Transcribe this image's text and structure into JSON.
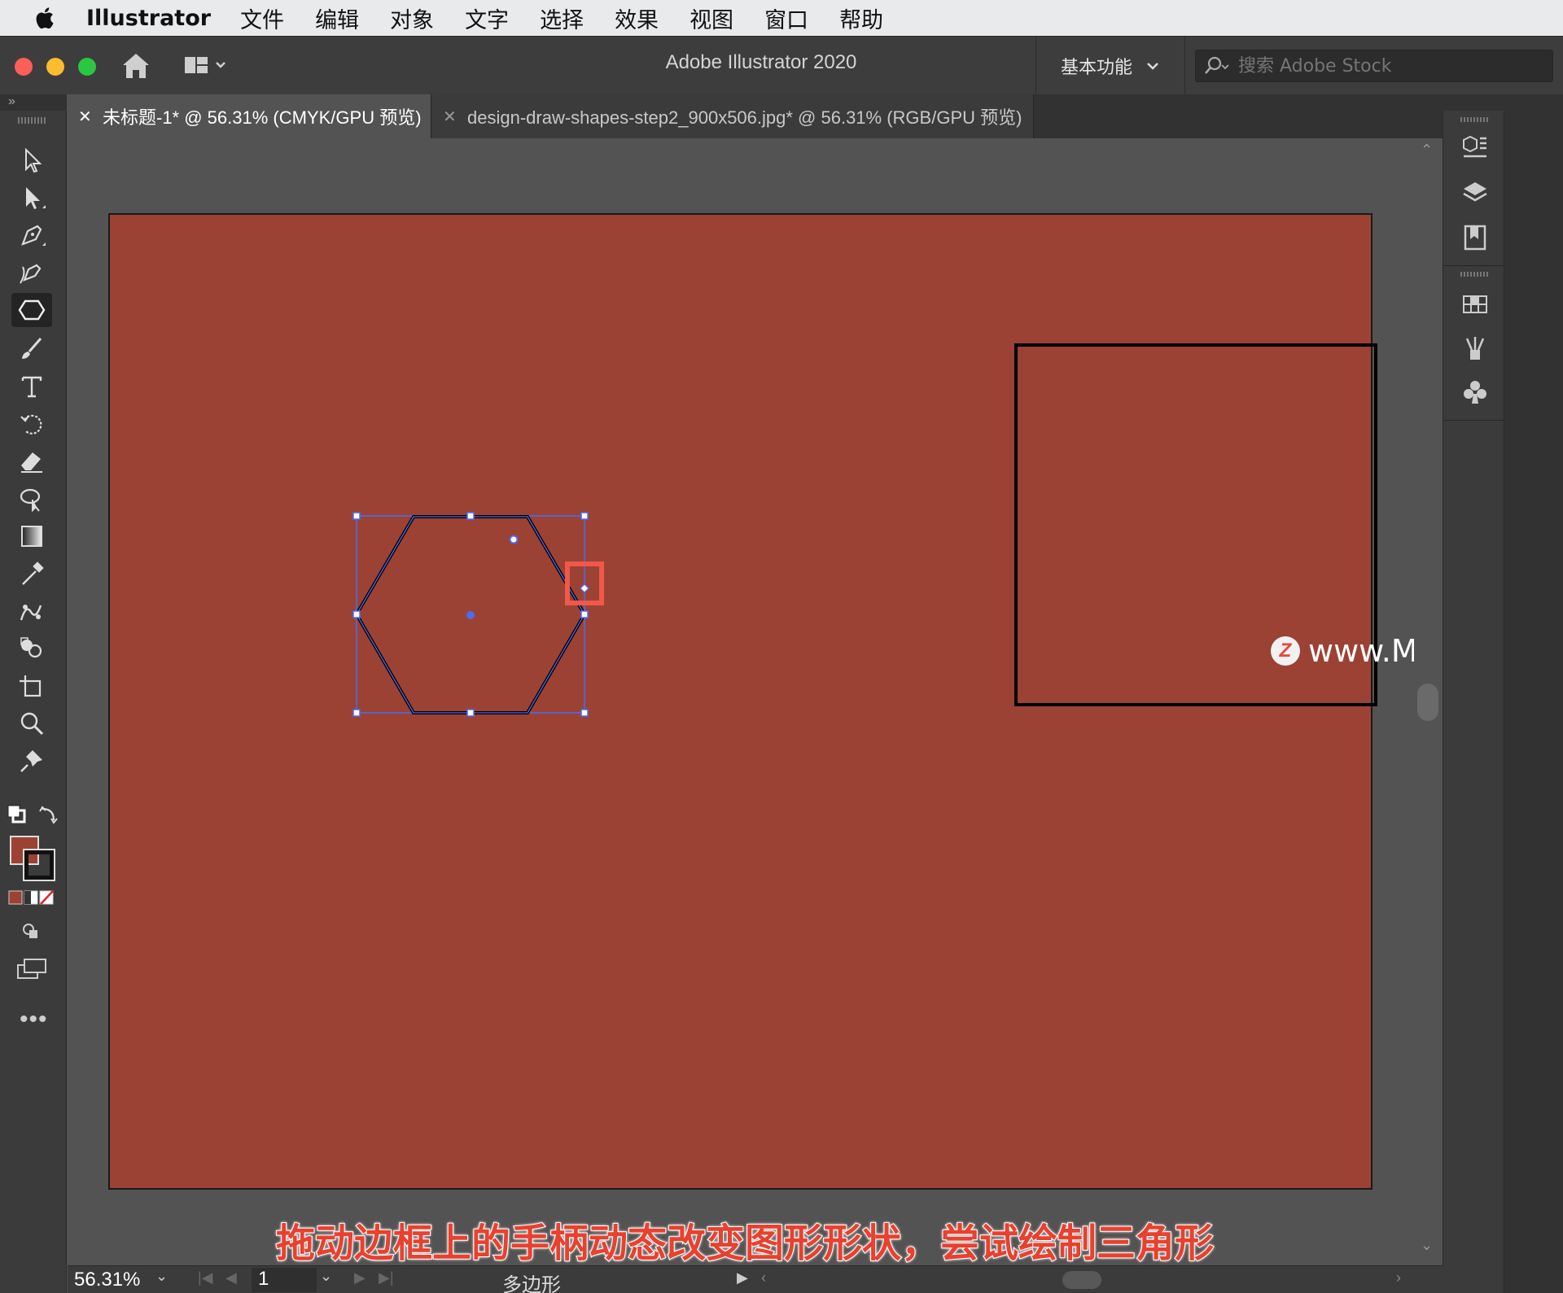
{
  "menubar": {
    "app_name": "Illustrator",
    "items": [
      "文件",
      "编辑",
      "对象",
      "文字",
      "选择",
      "效果",
      "视图",
      "窗口",
      "帮助"
    ]
  },
  "titlebar": {
    "window_title": "Adobe Illustrator 2020",
    "workspace_label": "基本功能",
    "stock_search_placeholder": "搜索 Adobe Stock"
  },
  "tabs": [
    {
      "label": "未标题-1* @ 56.31% (CMYK/GPU 预览)",
      "active": true
    },
    {
      "label": "design-draw-shapes-step2_900x506.jpg* @ 56.31% (RGB/GPU 预览)",
      "active": false
    }
  ],
  "toolbar": {
    "tools": [
      "selection-tool",
      "direct-selection-tool",
      "pen-tool",
      "curvature-tool",
      "polygon-tool",
      "paintbrush-tool",
      "type-tool",
      "rotate-tool",
      "eraser-tool",
      "puppet-warp-tool",
      "gradient-tool",
      "eyedropper-tool",
      "blend-tool",
      "shape-builder-tool",
      "artboard-tool",
      "zoom-tool",
      "pin-tool"
    ],
    "selected_tool": "polygon-tool",
    "fill_color": "#9b4234",
    "stroke_color": "#111111"
  },
  "canvas": {
    "artboard_color": "#9b4234",
    "selection_color": "#4a6cf0",
    "highlight_color": "#f0584a"
  },
  "watermark": "www.MacZ.com",
  "caption": "拖动边框上的手柄动态改变图形形状，尝试绘制三角形",
  "statusbar": {
    "zoom": "56.31%",
    "artboard_number": "1",
    "current_tool": "多边形"
  }
}
